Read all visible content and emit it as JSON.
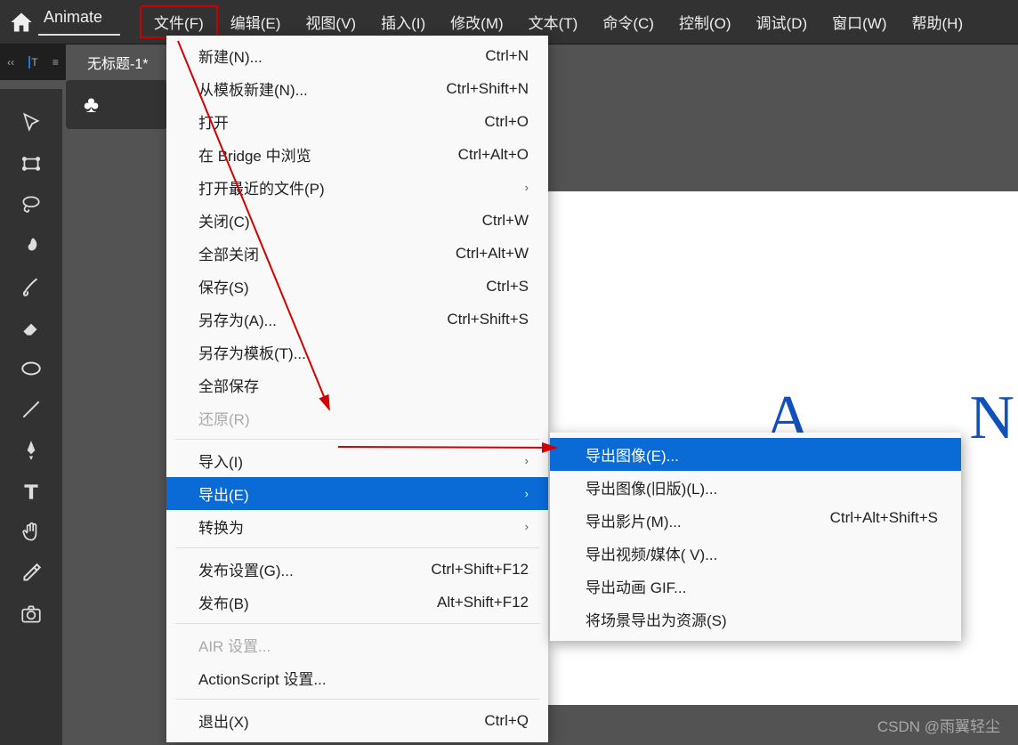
{
  "app": {
    "title": "Animate"
  },
  "menu": {
    "file": "文件(F)",
    "edit": "编辑(E)",
    "view": "视图(V)",
    "insert": "插入(I)",
    "modify": "修改(M)",
    "text": "文本(T)",
    "commands": "命令(C)",
    "control": "控制(O)",
    "debug": "调试(D)",
    "window": "窗口(W)",
    "help": "帮助(H)"
  },
  "doc_tab": "无标题-1*",
  "file_menu": {
    "new": {
      "label": "新建(N)...",
      "shortcut": "Ctrl+N"
    },
    "new_from_template": {
      "label": "从模板新建(N)...",
      "shortcut": "Ctrl+Shift+N"
    },
    "open": {
      "label": "打开",
      "shortcut": "Ctrl+O"
    },
    "browse_bridge": {
      "label": "在 Bridge 中浏览",
      "shortcut": "Ctrl+Alt+O"
    },
    "open_recent": {
      "label": "打开最近的文件(P)",
      "shortcut": ""
    },
    "close": {
      "label": "关闭(C)",
      "shortcut": "Ctrl+W"
    },
    "close_all": {
      "label": "全部关闭",
      "shortcut": "Ctrl+Alt+W"
    },
    "save": {
      "label": "保存(S)",
      "shortcut": "Ctrl+S"
    },
    "save_as": {
      "label": "另存为(A)...",
      "shortcut": "Ctrl+Shift+S"
    },
    "save_as_template": {
      "label": "另存为模板(T)...",
      "shortcut": ""
    },
    "save_all": {
      "label": "全部保存",
      "shortcut": ""
    },
    "revert": {
      "label": "还原(R)",
      "shortcut": ""
    },
    "import": {
      "label": "导入(I)",
      "shortcut": ""
    },
    "export": {
      "label": "导出(E)",
      "shortcut": ""
    },
    "convert_to": {
      "label": "转换为",
      "shortcut": ""
    },
    "publish_settings": {
      "label": "发布设置(G)...",
      "shortcut": "Ctrl+Shift+F12"
    },
    "publish": {
      "label": "发布(B)",
      "shortcut": "Alt+Shift+F12"
    },
    "air_settings": {
      "label": "AIR 设置...",
      "shortcut": ""
    },
    "actionscript_settings": {
      "label": "ActionScript 设置...",
      "shortcut": ""
    },
    "exit": {
      "label": "退出(X)",
      "shortcut": "Ctrl+Q"
    }
  },
  "export_submenu": {
    "export_image": {
      "label": "导出图像(E)...",
      "shortcut": ""
    },
    "export_image_legacy": {
      "label": "导出图像(旧版)(L)...",
      "shortcut": ""
    },
    "export_movie": {
      "label": "导出影片(M)...",
      "shortcut": "Ctrl+Alt+Shift+S"
    },
    "export_video": {
      "label": "导出视频/媒体( V)...",
      "shortcut": ""
    },
    "export_gif": {
      "label": "导出动画 GIF...",
      "shortcut": ""
    },
    "export_scene_resource": {
      "label": "将场景导出为资源(S)",
      "shortcut": ""
    }
  },
  "canvas": {
    "letter_a": "A",
    "letter_n": "N"
  },
  "watermark": "CSDN @雨翼轻尘",
  "icons": {
    "chevron": "›"
  }
}
